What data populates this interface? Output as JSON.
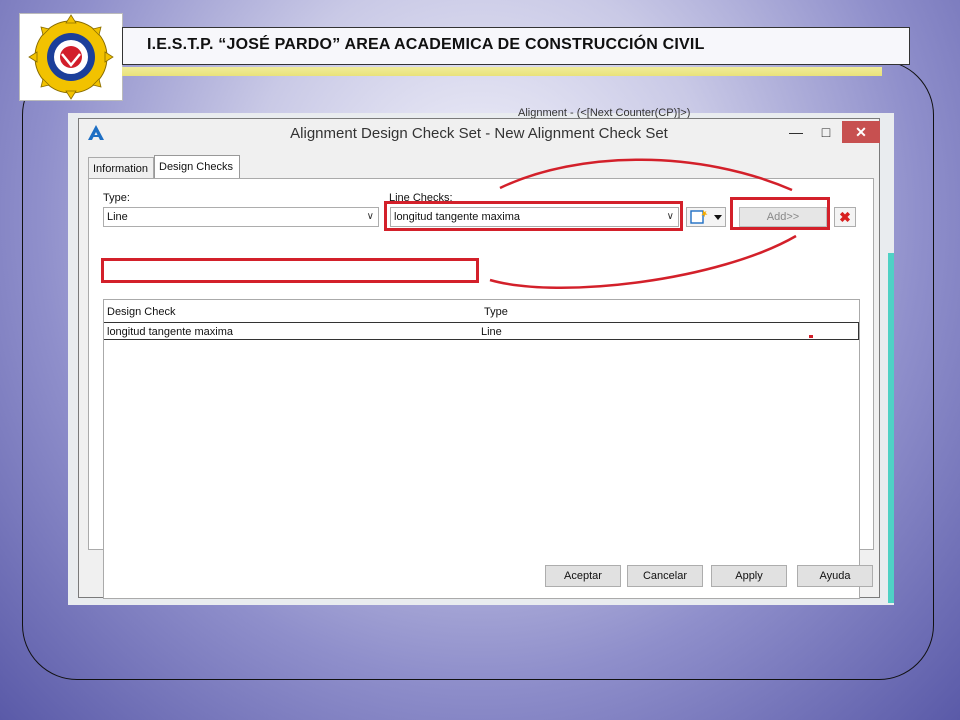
{
  "slide": {
    "header_title": "I.E.S.T.P. “JOSÉ PARDO” AREA ACADEMICA DE CONSTRUCCIÓN CIVIL"
  },
  "background_app": {
    "top_text": "Alignment - (<[Next Counter(CP)]>)"
  },
  "dialog": {
    "title": "Alignment Design Check Set - New Alignment Check Set",
    "tabs": [
      {
        "label": "Information",
        "active": false
      },
      {
        "label": "Design Checks",
        "active": true
      }
    ],
    "type_label": "Type:",
    "type_value": "Line",
    "line_checks_label": "Line Checks:",
    "line_checks_value": "longitud tangente maxima",
    "add_label": "Add>>",
    "list": {
      "columns": [
        "Design Check",
        "Type"
      ],
      "rows": [
        {
          "design_check": "longitud tangente maxima",
          "type": "Line"
        }
      ]
    },
    "buttons": {
      "ok": "Aceptar",
      "cancel": "Cancelar",
      "apply": "Apply",
      "help": "Ayuda"
    }
  },
  "colors": {
    "annotation_red": "#d3202a",
    "close_button": "#c75050",
    "accent_blue": "#1e6fc4"
  }
}
